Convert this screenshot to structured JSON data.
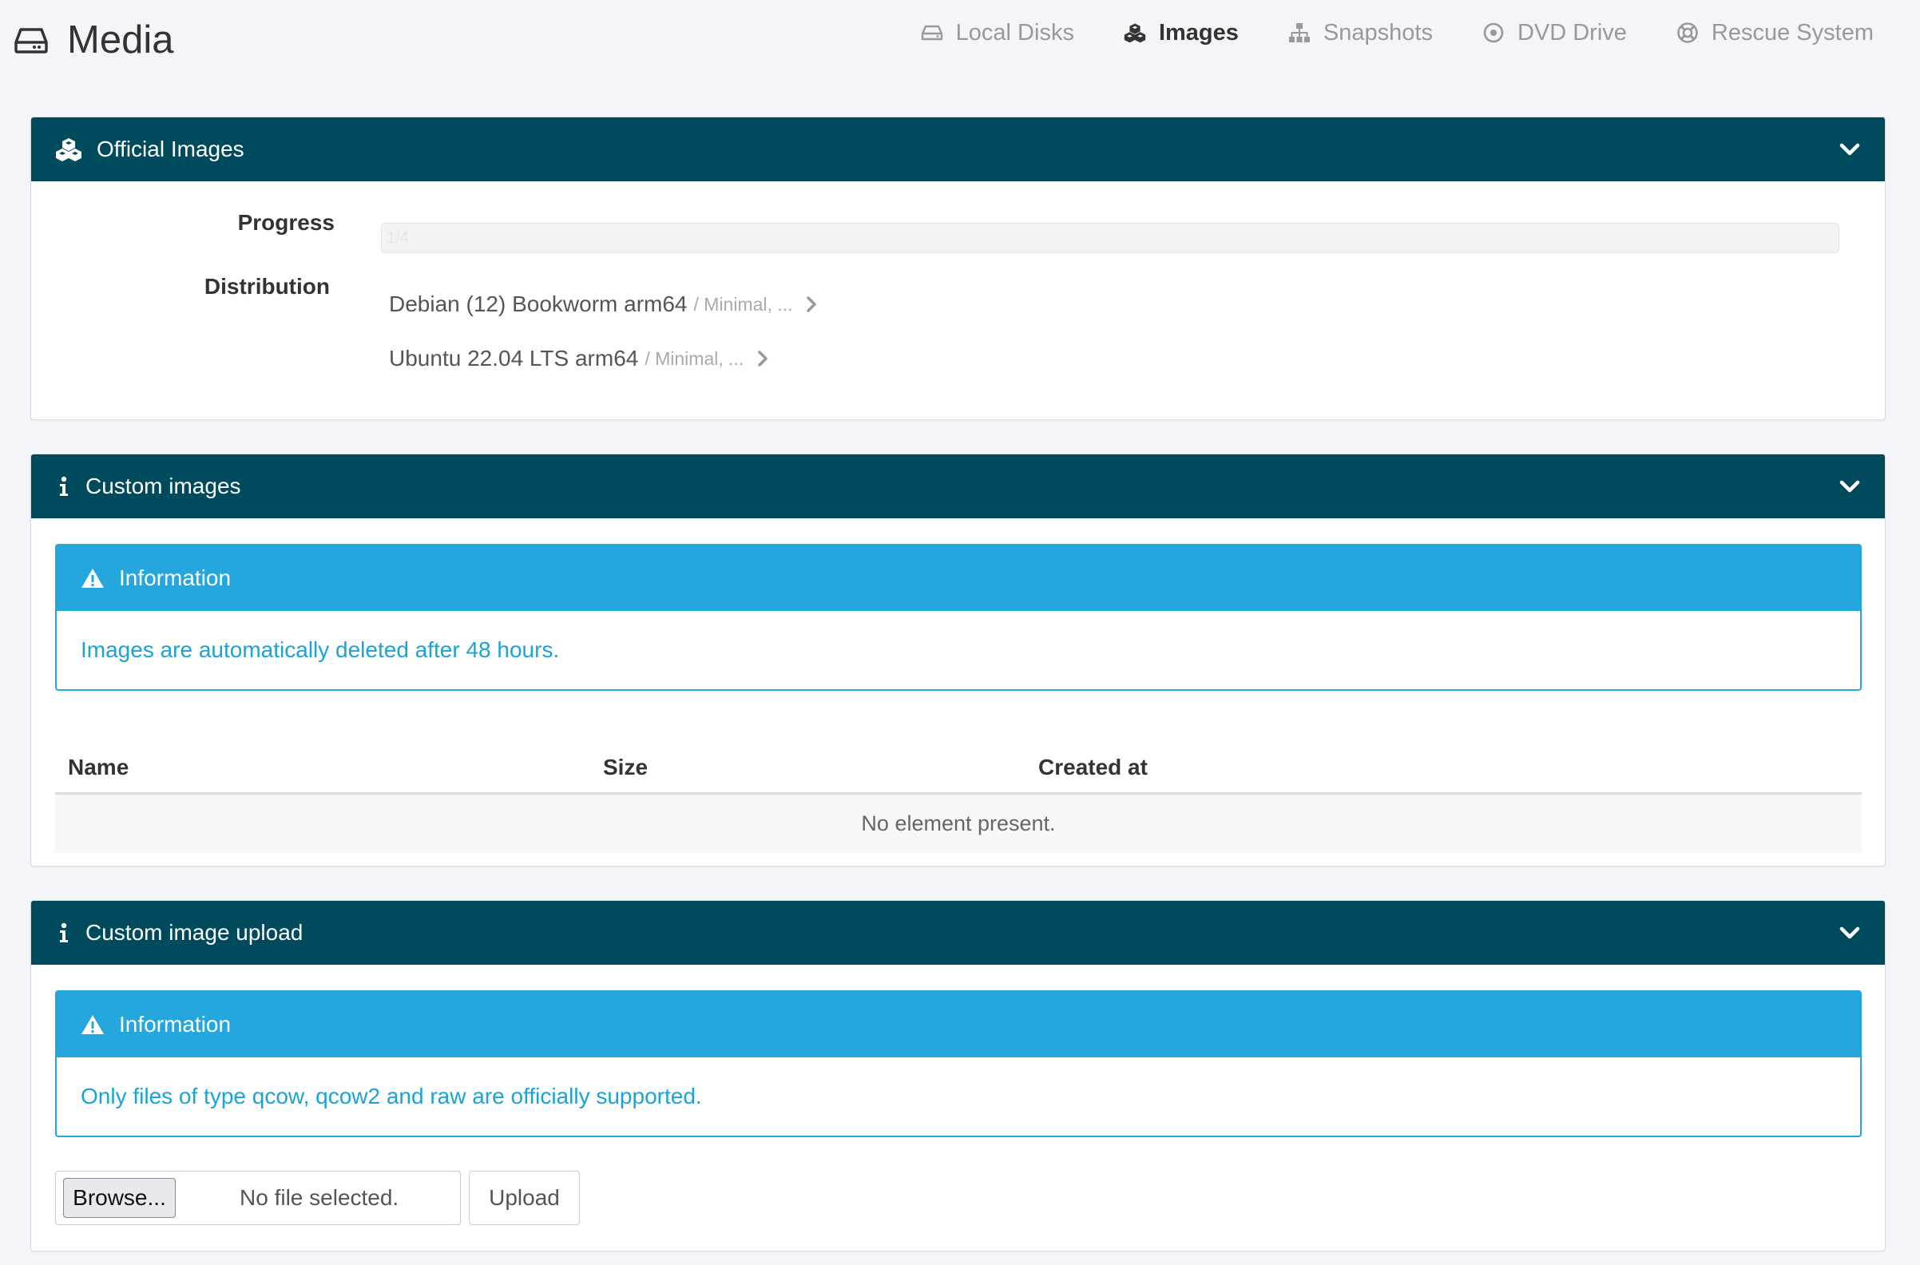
{
  "header": {
    "title": "Media",
    "tabs": [
      {
        "label": "Local Disks",
        "icon": "hdd-icon",
        "active": false
      },
      {
        "label": "Images",
        "icon": "cubes-icon",
        "active": true
      },
      {
        "label": "Snapshots",
        "icon": "sitemap-icon",
        "active": false
      },
      {
        "label": "DVD Drive",
        "icon": "disc-icon",
        "active": false
      },
      {
        "label": "Rescue System",
        "icon": "lifebuoy-icon",
        "active": false
      }
    ]
  },
  "official": {
    "title": "Official Images",
    "progress_label": "Progress",
    "progress_text": "1/4",
    "progress_value": 0.25,
    "distribution_label": "Distribution",
    "distributions": [
      {
        "name": "Debian (12) Bookworm arm64",
        "sub": "/ Minimal, ..."
      },
      {
        "name": "Ubuntu 22.04 LTS arm64",
        "sub": "/ Minimal, ..."
      }
    ]
  },
  "custom": {
    "title": "Custom images",
    "alert_title": "Information",
    "alert_text": "Images are automatically deleted after 48 hours.",
    "columns": [
      "Name",
      "Size",
      "Created at"
    ],
    "empty_text": "No element present."
  },
  "upload": {
    "title": "Custom image upload",
    "alert_title": "Information",
    "alert_text": "Only files of type qcow, qcow2 and raw are officially supported.",
    "browse_label": "Browse...",
    "file_status": "No file selected.",
    "upload_label": "Upload"
  },
  "colors": {
    "panel_header": "#004a5e",
    "info_blue": "#25a7de",
    "background": "#f4f5f8"
  }
}
